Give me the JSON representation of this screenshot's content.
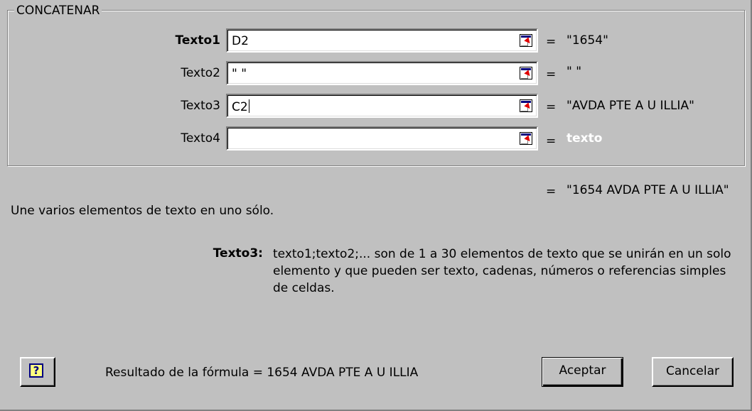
{
  "dialog": {
    "function_name": "CONCATENAR",
    "arguments": [
      {
        "label": "Texto1",
        "value": "D2",
        "result": "\"1654\"",
        "bold": true,
        "caret": false,
        "hint": false
      },
      {
        "label": "Texto2",
        "value": "\" \"",
        "result": "\" \"",
        "bold": false,
        "caret": false,
        "hint": false
      },
      {
        "label": "Texto3",
        "value": "C2",
        "result": "\"AVDA PTE A U ILLIA\"",
        "bold": false,
        "caret": true,
        "hint": false
      },
      {
        "label": "Texto4",
        "value": "",
        "result": "texto",
        "bold": false,
        "caret": false,
        "hint": true
      }
    ],
    "equals_sign": "=",
    "overall_result": "\"1654 AVDA PTE A U ILLIA\"",
    "description": "Une varios elementos de texto en uno sólo.",
    "help_argument_label": "Texto3:",
    "help_argument_text": "texto1;texto2;... son de 1 a 30 elementos de texto que se unirán en un solo elemento y que pueden ser texto, cadenas, números o referencias simples de celdas.",
    "formula_result_label": "Resultado de la fórmula =",
    "formula_result_value": "1654 AVDA PTE A U ILLIA",
    "help_button_glyph": "?",
    "ok_label": "Aceptar",
    "cancel_label": "Cancelar",
    "icons": {
      "collapse_dialog": "collapse-dialog-icon",
      "help": "help-icon"
    },
    "colors": {
      "face": "#c0c0c0",
      "hint_text": "#ffffff",
      "help_icon_fill": "#ffff80",
      "help_icon_border": "#000080",
      "ref_arrow": "#e00000"
    }
  }
}
